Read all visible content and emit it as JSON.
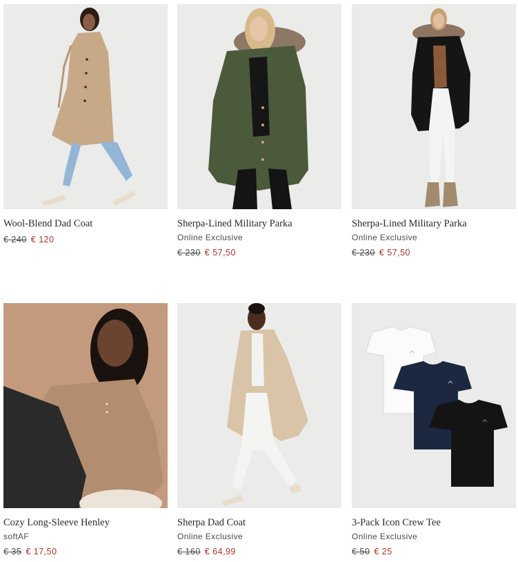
{
  "products": [
    {
      "name": "Wool-Blend Dad Coat",
      "tag": "",
      "old_price": "€ 240",
      "new_price": "€ 120"
    },
    {
      "name": "Sherpa-Lined Military Parka",
      "tag": "Online Exclusive",
      "old_price": "€ 230",
      "new_price": "€ 57,50"
    },
    {
      "name": "Sherpa-Lined Military Parka",
      "tag": "Online Exclusive",
      "old_price": "€ 230",
      "new_price": "€ 57,50"
    },
    {
      "name": "Cozy Long-Sleeve Henley",
      "tag": "softAF",
      "old_price": "€ 35",
      "new_price": "€ 17,50"
    },
    {
      "name": "Sherpa Dad Coat",
      "tag": "Online Exclusive",
      "old_price": "€ 160",
      "new_price": "€ 64,99"
    },
    {
      "name": "3-Pack Icon Crew Tee",
      "tag": "Online Exclusive",
      "old_price": "€ 50",
      "new_price": "€ 25"
    }
  ],
  "colors": {
    "sale_price": "#a8362a",
    "text": "#2a2a2a",
    "image_bg_light": "#ebebea",
    "image_bg_warm": "#c49a7e"
  }
}
